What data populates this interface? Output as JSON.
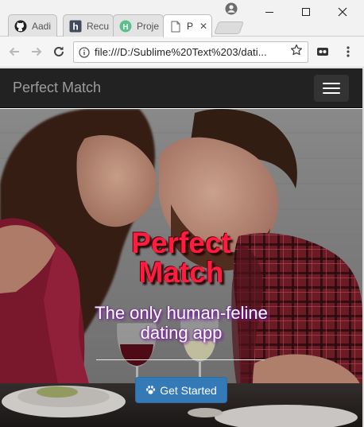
{
  "browser": {
    "tabs": [
      {
        "label": "Aadi",
        "icon": "github-icon"
      },
      {
        "label": "Recu",
        "icon": "hackerrank-icon"
      },
      {
        "label": "Proje",
        "icon": "hackerearth-icon"
      },
      {
        "label": "P",
        "icon": "page-icon",
        "active": true
      }
    ],
    "url": "file:///D:/Sublime%20Text%203/dati..."
  },
  "site": {
    "brand": "Perfect Match",
    "hero": {
      "title_line1": "Perfect",
      "title_line2": "Match",
      "subtitle": "The only human-feline dating app",
      "cta_label": "Get Started",
      "cta_icon": "paw-icon"
    }
  },
  "colors": {
    "navbar_bg": "#222222",
    "brand_text": "#9d9d9d",
    "title_red": "#ff1c3e",
    "cta_blue": "#337ab7"
  }
}
